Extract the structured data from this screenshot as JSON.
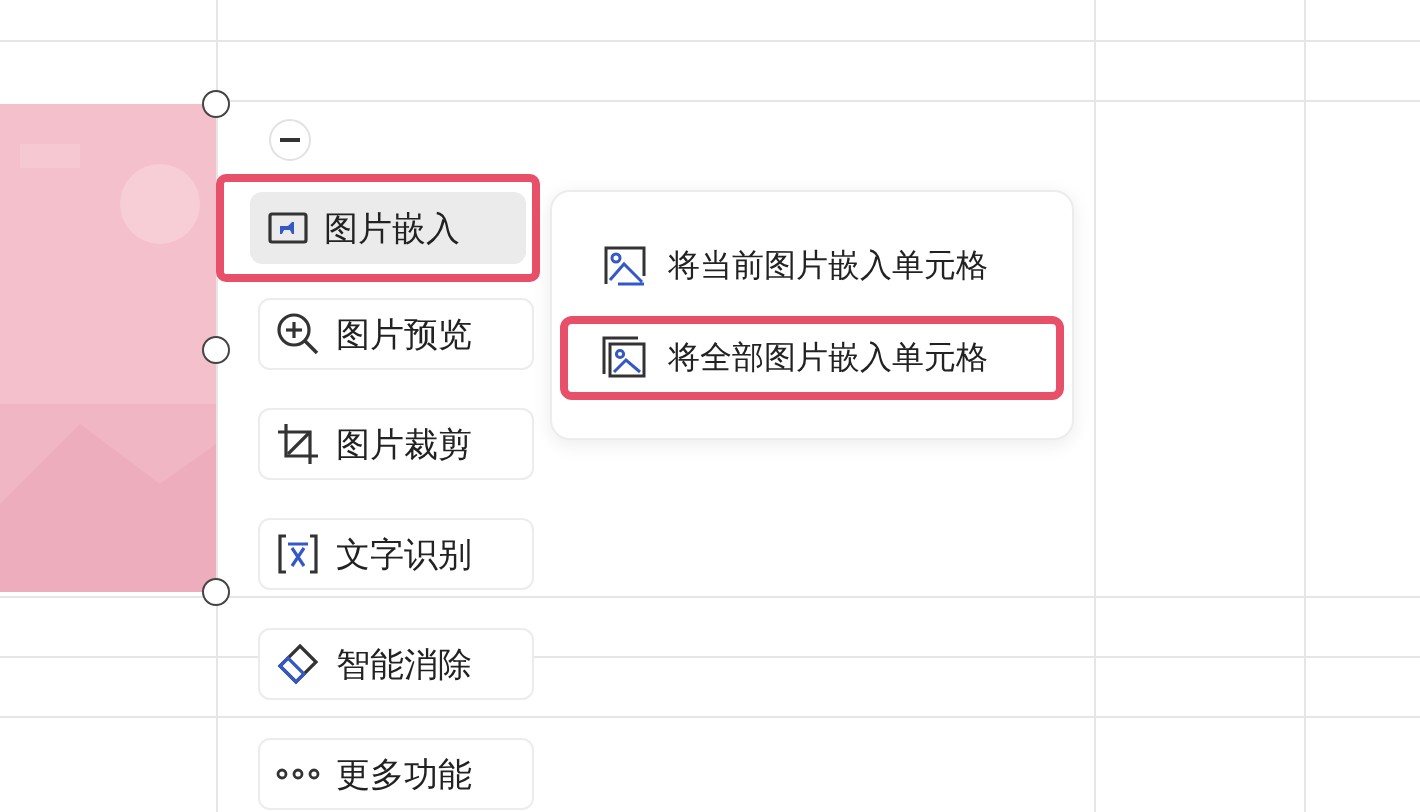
{
  "toolbar": {
    "buttons": [
      {
        "kind": "embed",
        "label": "图片嵌入",
        "selected": true,
        "highlighted": true
      },
      {
        "kind": "preview",
        "label": "图片预览",
        "selected": false,
        "highlighted": false
      },
      {
        "kind": "crop",
        "label": "图片裁剪",
        "selected": false,
        "highlighted": false
      },
      {
        "kind": "ocr",
        "label": "文字识别",
        "selected": false,
        "highlighted": false
      },
      {
        "kind": "erase",
        "label": "智能消除",
        "selected": false,
        "highlighted": false
      },
      {
        "kind": "more",
        "label": "更多功能",
        "selected": false,
        "highlighted": false
      }
    ]
  },
  "submenu": {
    "items": [
      {
        "kind": "single",
        "label": "将当前图片嵌入单元格",
        "highlighted": false
      },
      {
        "kind": "all",
        "label": "将全部图片嵌入单元格",
        "highlighted": true
      }
    ]
  }
}
